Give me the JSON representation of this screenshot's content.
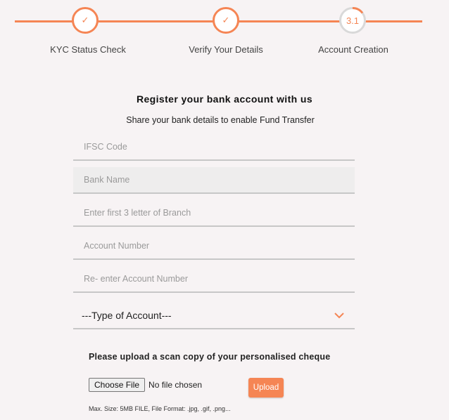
{
  "stepper": {
    "steps": [
      {
        "label": "KYC Status Check",
        "mark": "✓",
        "state": "done"
      },
      {
        "label": "Verify Your Details",
        "mark": "✓",
        "state": "done"
      },
      {
        "label": "Account Creation",
        "mark": "3.1",
        "state": "current"
      }
    ],
    "accent": "#f58554"
  },
  "form": {
    "title": "Register your bank account with us",
    "subtitle": "Share your bank details to enable Fund Transfer",
    "ifsc_placeholder": "IFSC Code",
    "bank_name_placeholder": "Bank Name",
    "branch_placeholder": "Enter first 3 letter of Branch",
    "account_number_placeholder": "Account Number",
    "reenter_account_placeholder": "Re- enter Account Number",
    "account_type_selected": "---Type of Account---",
    "upload_title": "Please upload a scan copy of your personalised cheque",
    "choose_file_label": "Choose File",
    "no_file_text": "No file chosen",
    "upload_label": "Upload",
    "hint": "Max. Size: 5MB FILE, File Format: .jpg, .gif, .png..."
  },
  "icons": {
    "check": "check-icon",
    "dropdown": "chevron-down-icon"
  }
}
